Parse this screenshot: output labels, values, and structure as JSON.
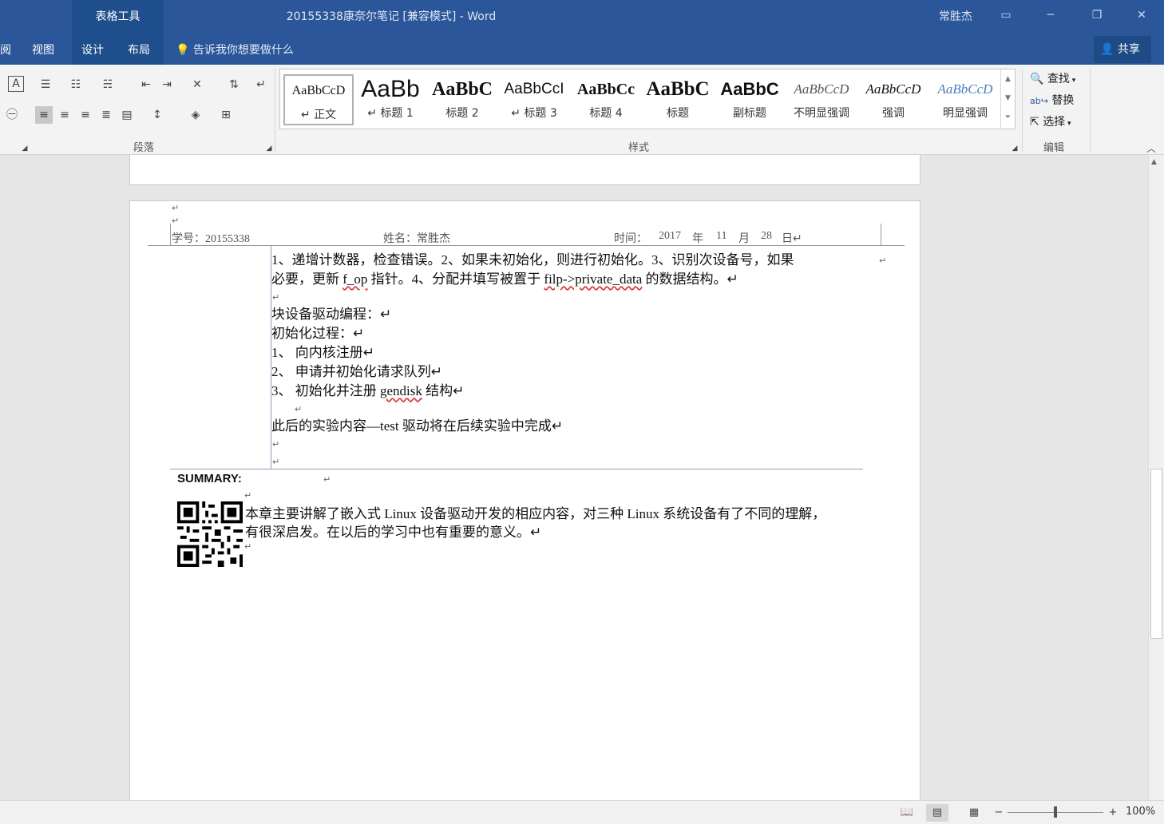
{
  "window": {
    "context_tab": "表格工具",
    "title": "20155338康奈尔笔记 [兼容模式] - Word",
    "user": "常胜杰",
    "controls": [
      "restore-ribbon",
      "minimize",
      "maximize",
      "close"
    ]
  },
  "tabs": [
    {
      "label": "阅"
    },
    {
      "label": "视图"
    },
    {
      "label": "设计"
    },
    {
      "label": "布局"
    }
  ],
  "tellme": "告诉我你想要做什么",
  "share_label": "共享",
  "ribbon": {
    "paragraph_label": "段落",
    "styles_label": "样式",
    "editing_label": "编辑",
    "styles": [
      {
        "sample": "AaBbCcD",
        "name": "↵ 正文"
      },
      {
        "sample": "AaBb",
        "name": "↵ 标题 1"
      },
      {
        "sample": "AaBbC",
        "name": "标题 2"
      },
      {
        "sample": "AaBbCcI",
        "name": "↵ 标题 3"
      },
      {
        "sample": "AaBbCc",
        "name": "标题 4"
      },
      {
        "sample": "AaBbC",
        "name": "标题"
      },
      {
        "sample": "AaBbC",
        "name": "副标题"
      },
      {
        "sample": "AaBbCcD",
        "name": "不明显强调"
      },
      {
        "sample": "AaBbCcD",
        "name": "强调"
      },
      {
        "sample": "AaBbCcD",
        "name": "明显强调"
      }
    ],
    "editing": {
      "find": "查找",
      "replace": "替换",
      "select": "选择"
    }
  },
  "document": {
    "header": {
      "student_id": "学号：20155338",
      "name": "姓名：常胜杰",
      "time_prefix": "时间：",
      "year": "2017",
      "year_unit": "年",
      "month": "11",
      "month_unit": "月",
      "day": "28",
      "day_unit": "日↵"
    },
    "para1_line1": "1、递增计数器，检查错误。2、如果未初始化，则进行初始化。3、识别次设备号，如果",
    "para1_line2_a": "必要，更新 ",
    "para1_line2_b": "f_op",
    "para1_line2_c": " 指针。4、分配并填写被置于 ",
    "para1_line2_d": "filp->private_data",
    "para1_line2_e": " 的数据结构。↵",
    "block_title": "块设备驱动编程：↵",
    "init_title": "初始化过程：↵",
    "step1": "1、 向内核注册↵",
    "step2": "2、 申请并初始化请求队列↵",
    "step3_a": "3、 初始化并注册 ",
    "step3_b": "gendisk",
    "step3_c": " 结构↵",
    "later": "此后的实验内容—test 驱动将在后续实验中完成↵",
    "summary_title": "SUMMARY:",
    "summary_line1": "本章主要讲解了嵌入式 Linux 设备驱动开发的相应内容，对三种 Linux 系统设备有了不同的理解，",
    "summary_line2": "有很深启发。在以后的学习中也有重要的意义。↵"
  },
  "status": {
    "zoom": "100%",
    "zoom_fraction": 0.5
  },
  "colors": {
    "title_bar": "#2b579a",
    "context_tab": "#1f4e8c",
    "ribbon": "#f3f3f3",
    "canvas": "#e6e6e6"
  }
}
